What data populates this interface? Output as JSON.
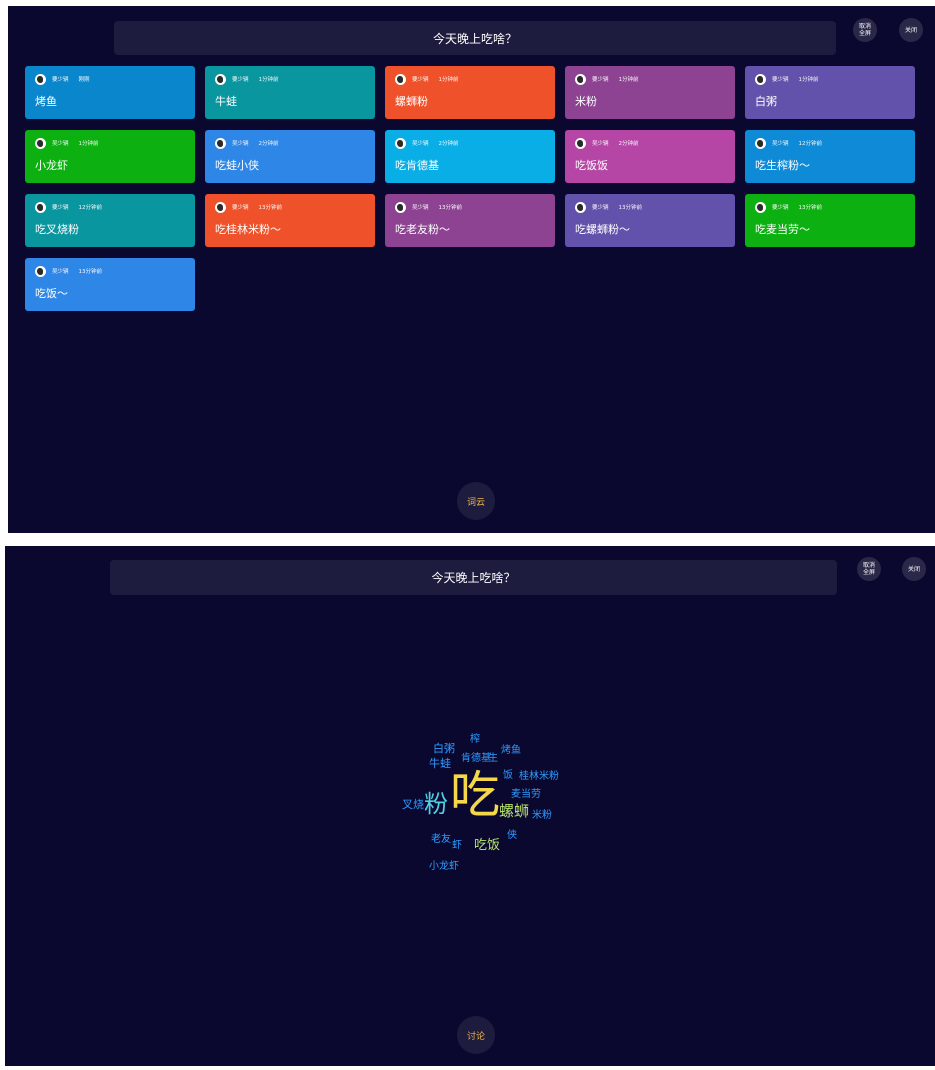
{
  "colors": {
    "background": "#0b0830",
    "title_bar": "#1e1c3e",
    "bottom_button_text": "#f0b64a"
  },
  "top_panel": {
    "title": "今天晚上吃啥？",
    "exit_fullscreen": "取消全屏",
    "close": "关闭",
    "bottom_button": "词云",
    "cards": [
      {
        "author": "要少辆",
        "time": "刚刚",
        "text": "烤鱼",
        "color": "#0a86cc"
      },
      {
        "author": "要少辆",
        "time": "1分钟前",
        "text": "牛蛙",
        "color": "#0a969f"
      },
      {
        "author": "要少辆",
        "time": "1分钟前",
        "text": "螺蛳粉",
        "color": "#ef522a"
      },
      {
        "author": "要少辆",
        "time": "1分钟前",
        "text": "米粉",
        "color": "#8d4392"
      },
      {
        "author": "要少辆",
        "time": "1分钟前",
        "text": "白粥",
        "color": "#6352ab"
      },
      {
        "author": "吴少辆",
        "time": "1分钟前",
        "text": "小龙虾",
        "color": "#0cb111"
      },
      {
        "author": "吴少辆",
        "time": "2分钟前",
        "text": "吃蛙小侠",
        "color": "#2e86e6"
      },
      {
        "author": "吴少辆",
        "time": "2分钟前",
        "text": "吃肯德基",
        "color": "#0aaee6"
      },
      {
        "author": "吴少辆",
        "time": "2分钟前",
        "text": "吃饭饭",
        "color": "#b646a6"
      },
      {
        "author": "吴少辆",
        "time": "12分钟前",
        "text": "吃生榨粉～",
        "color": "#0e8ad6"
      },
      {
        "author": "要少辆",
        "time": "12分钟前",
        "text": "吃叉烧粉",
        "color": "#0a969f"
      },
      {
        "author": "要少辆",
        "time": "13分钟前",
        "text": "吃桂林米粉～",
        "color": "#ef522a"
      },
      {
        "author": "吴少辆",
        "time": "13分钟前",
        "text": "吃老友粉～",
        "color": "#8d4392"
      },
      {
        "author": "要少辆",
        "time": "13分钟前",
        "text": "吃螺蛳粉～",
        "color": "#6352ab"
      },
      {
        "author": "要少辆",
        "time": "13分钟前",
        "text": "吃麦当劳～",
        "color": "#0cb111"
      },
      {
        "author": "吴少辆",
        "time": "13分钟前",
        "text": "吃饭～",
        "color": "#2e86e6"
      }
    ]
  },
  "bottom_panel": {
    "title": "今天晚上吃啥？",
    "exit_fullscreen": "取消全屏",
    "close": "关闭",
    "bottom_button": "讨论",
    "word_cloud": [
      {
        "word": "吃",
        "color": "#f5d84a"
      },
      {
        "word": "粉",
        "color": "#4fd0e4"
      },
      {
        "word": "螺蛳",
        "color": "#b7e36a"
      },
      {
        "word": "吃饭",
        "color": "#b7e36a"
      },
      {
        "word": "叉烧",
        "color": "#2d9bff"
      },
      {
        "word": "白粥",
        "color": "#2d9bff"
      },
      {
        "word": "榨",
        "color": "#2d9bff"
      },
      {
        "word": "烤鱼",
        "color": "#2d9bff"
      },
      {
        "word": "牛蛙",
        "color": "#2d9bff"
      },
      {
        "word": "肯德基",
        "color": "#2d9bff"
      },
      {
        "word": "生",
        "color": "#2d9bff"
      },
      {
        "word": "饭",
        "color": "#2d9bff"
      },
      {
        "word": "桂林米粉",
        "color": "#2d9bff"
      },
      {
        "word": "麦当劳",
        "color": "#2d9bff"
      },
      {
        "word": "米粉",
        "color": "#2d9bff"
      },
      {
        "word": "侠",
        "color": "#2d9bff"
      },
      {
        "word": "老友",
        "color": "#2d9bff"
      },
      {
        "word": "虾",
        "color": "#2d9bff"
      },
      {
        "word": "小龙虾",
        "color": "#2d9bff"
      }
    ]
  }
}
